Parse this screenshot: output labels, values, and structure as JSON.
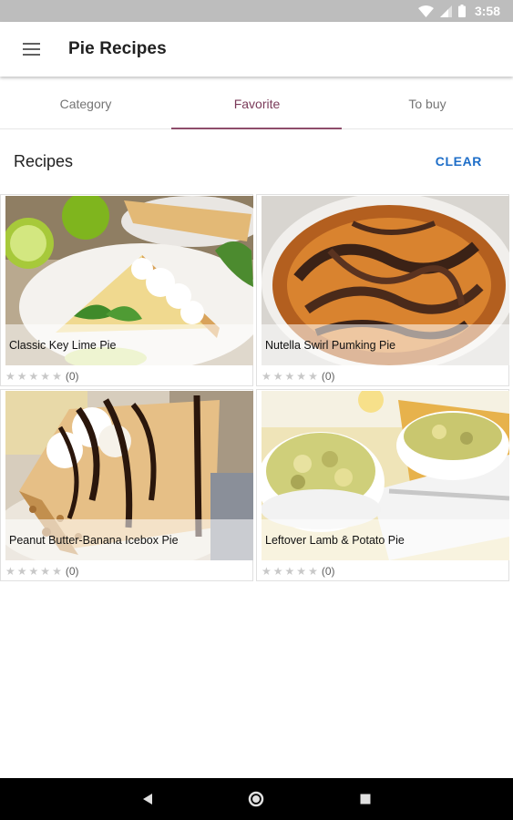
{
  "status_bar": {
    "time": "3:58",
    "icons": [
      "wifi-icon",
      "signal-icon",
      "battery-icon"
    ]
  },
  "app_bar": {
    "menu_icon": "menu-icon",
    "title": "Pie Recipes"
  },
  "tabs": [
    {
      "label": "Category",
      "active": false
    },
    {
      "label": "Favorite",
      "active": true
    },
    {
      "label": "To buy",
      "active": false
    }
  ],
  "section": {
    "title": "Recipes",
    "clear_label": "CLEAR"
  },
  "recipes": [
    {
      "title": "Classic Key Lime Pie",
      "rating_count": "(0)",
      "stars": 0,
      "image": "key-lime-pie-photo"
    },
    {
      "title": "Nutella Swirl Pumking Pie",
      "rating_count": "(0)",
      "stars": 0,
      "image": "nutella-pumpkin-pie-photo"
    },
    {
      "title": "Peanut Butter-Banana Icebox Pie",
      "rating_count": "(0)",
      "stars": 0,
      "image": "peanut-butter-pie-photo"
    },
    {
      "title": "Leftover Lamb & Potato Pie",
      "rating_count": "(0)",
      "stars": 0,
      "image": "lamb-potato-pie-photo"
    }
  ],
  "nav_bar": {
    "buttons": [
      "back-icon",
      "home-icon",
      "recents-icon"
    ]
  },
  "colors": {
    "status_bar": "#bdbdbd",
    "accent": "#8e4d6b",
    "clear_link": "#1e6ec8",
    "nav_bar": "#000000"
  }
}
